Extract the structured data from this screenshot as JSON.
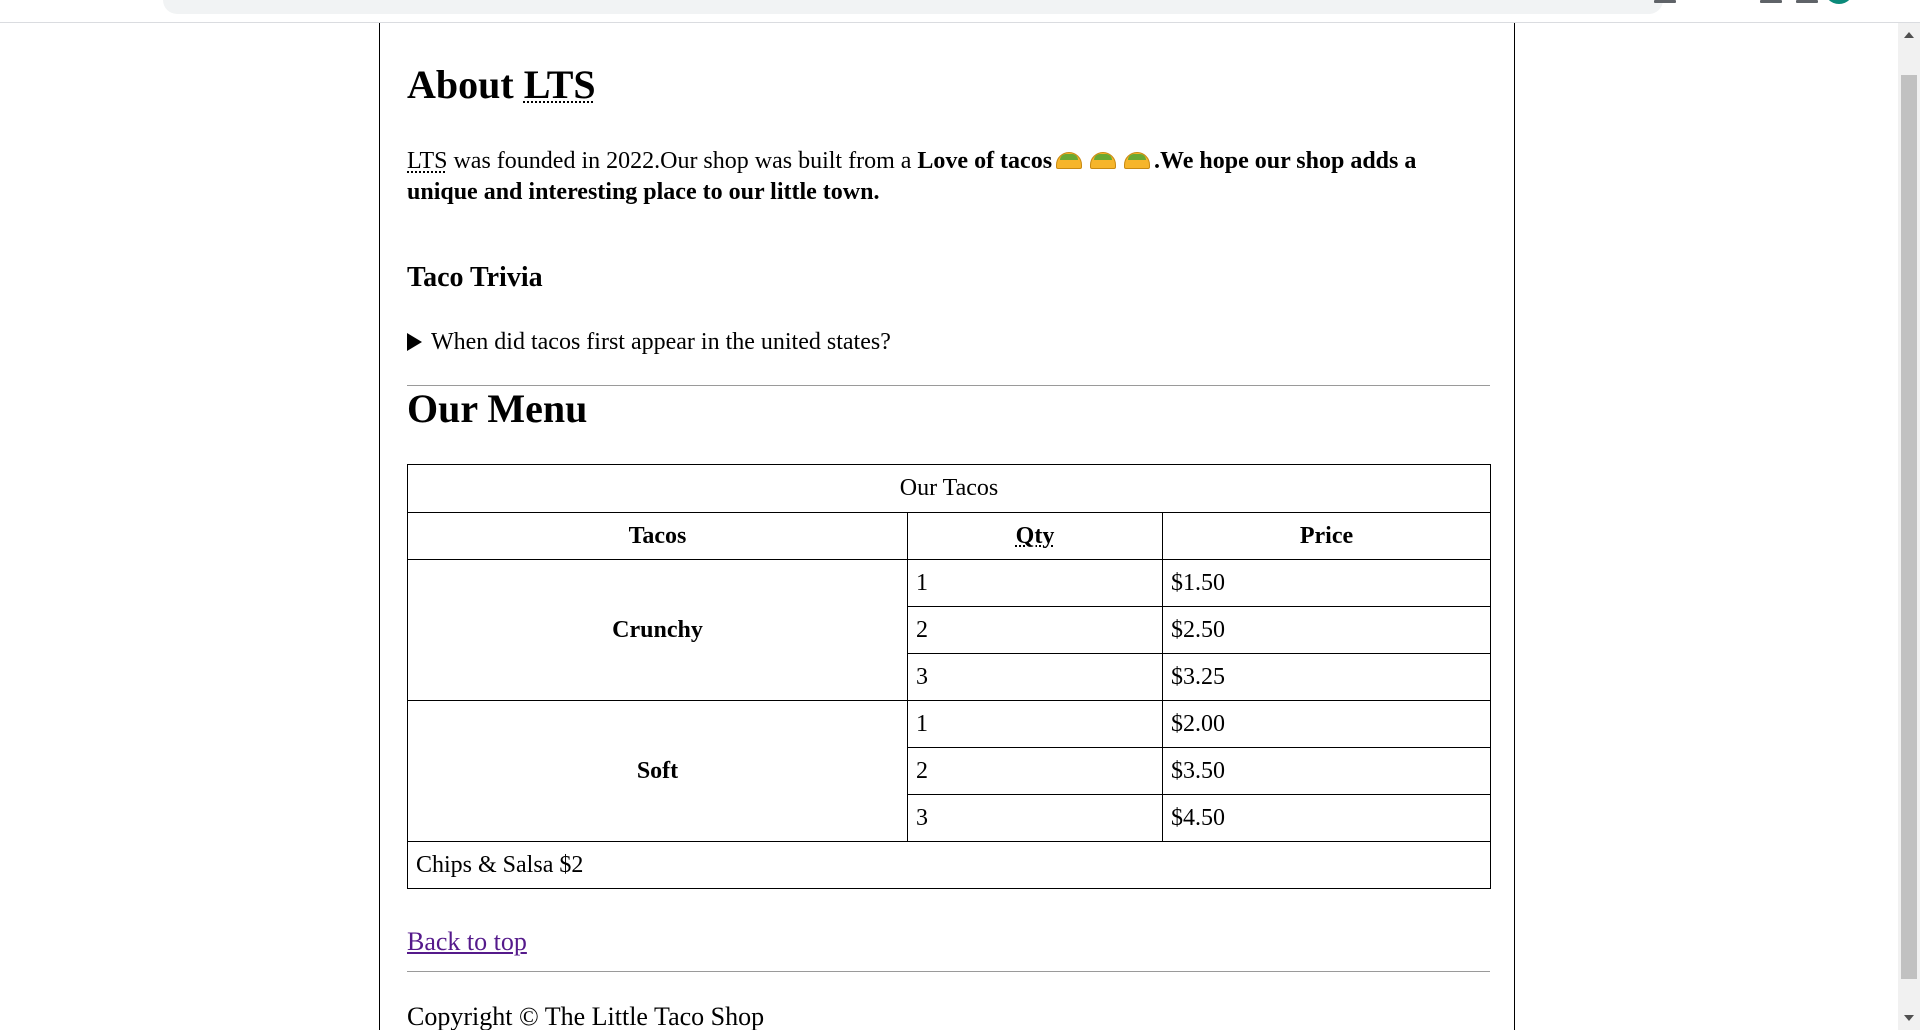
{
  "about": {
    "heading_prefix": "About",
    "heading_abbr": "LTS",
    "intro_abbr": "LTS",
    "intro_text": " was founded in 2022.Our shop was built from a ",
    "intro_bold1": "Love of tacos",
    "intro_bold2": ".We hope our shop adds a unique and interesting place to our little town."
  },
  "trivia": {
    "heading": "Taco Trivia",
    "question": "When did tacos first appear in the united states?"
  },
  "menu": {
    "heading": "Our Menu",
    "caption": "Our Tacos",
    "headers": {
      "tacos": "Tacos",
      "qty": "Qty",
      "price": "Price"
    },
    "groups": [
      {
        "type": "Crunchy",
        "rows": [
          {
            "qty": "1",
            "price": "$1.50"
          },
          {
            "qty": "2",
            "price": "$2.50"
          },
          {
            "qty": "3",
            "price": "$3.25"
          }
        ]
      },
      {
        "type": "Soft",
        "rows": [
          {
            "qty": "1",
            "price": "$2.00"
          },
          {
            "qty": "2",
            "price": "$3.50"
          },
          {
            "qty": "3",
            "price": "$4.50"
          }
        ]
      }
    ],
    "footer": "Chips & Salsa $2"
  },
  "back_to_top": "Back to top",
  "copyright": "Copyright © The Little Taco Shop",
  "icons": {
    "taco": "taco-icon"
  },
  "colors": {
    "link_visited": "#551a8b",
    "taco_shell": "#f6b52b",
    "lettuce": "#6aa832"
  }
}
